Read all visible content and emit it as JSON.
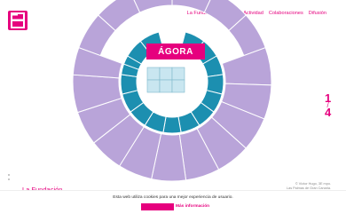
{
  "header": {
    "logo_icon": "brand-logo-icon",
    "nav": [
      {
        "label": "La Fundación"
      },
      {
        "label": "Áreas de Actividad"
      },
      {
        "label": "Colaboraciones"
      },
      {
        "label": "Difusión"
      }
    ]
  },
  "stage": {
    "label": "ÁGORA"
  },
  "pager": {
    "current": "1",
    "separator": "/",
    "total": "4"
  },
  "credits": {
    "line1": "© Víctor Hugo, 3E mpo.",
    "line2": "Las Palmas de Gran Canaria."
  },
  "section_title": "La Fundación",
  "cookie": {
    "text": "Esta web utiliza cookies para una mejor experiencia de usuario.",
    "accept_label": "",
    "more_label": "Más información"
  },
  "colors": {
    "brand": "#e6007e",
    "outer_ring": "#b9a4d9",
    "inner_ring": "#1c8fb0",
    "center_boxes": "#c9e6f0"
  }
}
